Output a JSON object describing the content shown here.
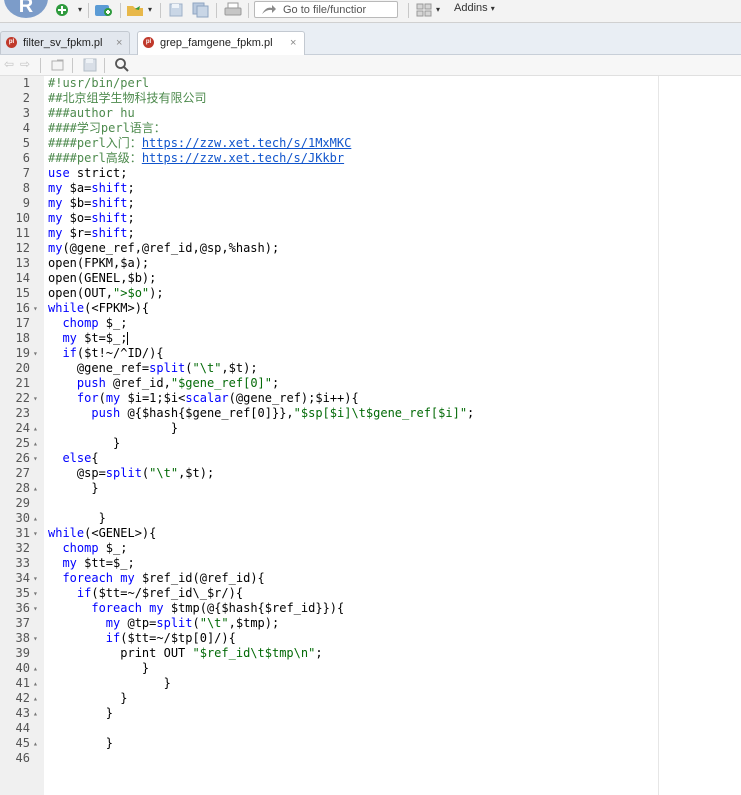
{
  "app": {
    "logo_text": "R",
    "goto_placeholder": "Go to file/functior",
    "addins_label": "Addins"
  },
  "tabs": [
    {
      "label": "filter_sv_fpkm.pl",
      "active": false
    },
    {
      "label": "grep_famgene_fpkm.pl",
      "active": true
    }
  ],
  "colors": {
    "keyword": "#0000ff",
    "comment": "#4d8a4d",
    "string": "#036a07",
    "url": "#1155cc"
  },
  "code_lines": [
    {
      "n": "1",
      "fold": "",
      "html": "<span class='cm'>#!usr/bin/perl</span>"
    },
    {
      "n": "2",
      "fold": "",
      "html": "<span class='cm'>##北京组学生物科技有限公司</span>"
    },
    {
      "n": "3",
      "fold": "",
      "html": "<span class='cm'>###author hu</span>"
    },
    {
      "n": "4",
      "fold": "",
      "html": "<span class='cm'>####学习perl语言：</span>"
    },
    {
      "n": "5",
      "fold": "",
      "html": "<span class='cm'>####perl入门：</span><span class='url'>https://zzw.xet.tech/s/1MxMKC</span>"
    },
    {
      "n": "6",
      "fold": "",
      "html": "<span class='cm'>####perl高级：</span><span class='url'>https://zzw.xet.tech/s/JKkbr</span>"
    },
    {
      "n": "7",
      "fold": "",
      "html": "<span class='kw'>use</span> strict;"
    },
    {
      "n": "8",
      "fold": "",
      "html": "<span class='kw'>my</span> $a=<span class='kw'>shift</span>;"
    },
    {
      "n": "9",
      "fold": "",
      "html": "<span class='kw'>my</span> $b=<span class='kw'>shift</span>;"
    },
    {
      "n": "10",
      "fold": "",
      "html": "<span class='kw'>my</span> $o=<span class='kw'>shift</span>;"
    },
    {
      "n": "11",
      "fold": "",
      "html": "<span class='kw'>my</span> $r=<span class='kw'>shift</span>;"
    },
    {
      "n": "12",
      "fold": "",
      "html": "<span class='kw'>my</span>(@gene_ref,@ref_id,@sp,%hash);"
    },
    {
      "n": "13",
      "fold": "",
      "html": "open(FPKM,$a);"
    },
    {
      "n": "14",
      "fold": "",
      "html": "open(GENEL,$b);"
    },
    {
      "n": "15",
      "fold": "",
      "html": "open(OUT,<span class='st'>\">$o\"</span>);"
    },
    {
      "n": "16",
      "fold": "▾",
      "html": "<span class='kw'>while</span>(&lt;FPKM&gt;){"
    },
    {
      "n": "17",
      "fold": "",
      "html": "  <span class='kw'>chomp</span> $_;"
    },
    {
      "n": "18",
      "fold": "",
      "html": "  <span class='kw'>my</span> $t=$_;<span class='cursor'></span>"
    },
    {
      "n": "19",
      "fold": "▾",
      "html": "  <span class='kw'>if</span>($t!~/^ID/){"
    },
    {
      "n": "20",
      "fold": "",
      "html": "    @gene_ref=<span class='kw'>split</span>(<span class='st'>\"\\t\"</span>,$t);"
    },
    {
      "n": "21",
      "fold": "",
      "html": "    <span class='kw'>push</span> @ref_id,<span class='st'>\"$gene_ref[0]\"</span>;"
    },
    {
      "n": "22",
      "fold": "▾",
      "html": "    <span class='kw'>for</span>(<span class='kw'>my</span> $i=1;$i&lt;<span class='kw'>scalar</span>(@gene_ref);$i++){"
    },
    {
      "n": "23",
      "fold": "",
      "html": "      <span class='kw'>push</span> @{$hash{$gene_ref[0]}},<span class='st'>\"$sp[$i]\\t$gene_ref[$i]\"</span>;"
    },
    {
      "n": "24",
      "fold": "▴",
      "html": "                 }"
    },
    {
      "n": "25",
      "fold": "▴",
      "html": "         }"
    },
    {
      "n": "26",
      "fold": "▾",
      "html": "  <span class='kw'>else</span>{"
    },
    {
      "n": "27",
      "fold": "",
      "html": "    @sp=<span class='kw'>split</span>(<span class='st'>\"\\t\"</span>,$t);"
    },
    {
      "n": "28",
      "fold": "▴",
      "html": "      }"
    },
    {
      "n": "29",
      "fold": "",
      "html": ""
    },
    {
      "n": "30",
      "fold": "▴",
      "html": "       }"
    },
    {
      "n": "31",
      "fold": "▾",
      "html": "<span class='kw'>while</span>(&lt;GENEL&gt;){"
    },
    {
      "n": "32",
      "fold": "",
      "html": "  <span class='kw'>chomp</span> $_;"
    },
    {
      "n": "33",
      "fold": "",
      "html": "  <span class='kw'>my</span> $tt=$_;"
    },
    {
      "n": "34",
      "fold": "▾",
      "html": "  <span class='kw'>foreach</span> <span class='kw'>my</span> $ref_id(@ref_id){"
    },
    {
      "n": "35",
      "fold": "▾",
      "html": "    <span class='kw'>if</span>($tt=~/$ref_id\\_$r/){"
    },
    {
      "n": "36",
      "fold": "▾",
      "html": "      <span class='kw'>foreach</span> <span class='kw'>my</span> $tmp(@{$hash{$ref_id}}){"
    },
    {
      "n": "37",
      "fold": "",
      "html": "        <span class='kw'>my</span> @tp=<span class='kw'>split</span>(<span class='st'>\"\\t\"</span>,$tmp);"
    },
    {
      "n": "38",
      "fold": "▾",
      "html": "        <span class='kw'>if</span>($tt=~/$tp[0]/){"
    },
    {
      "n": "39",
      "fold": "",
      "html": "          print OUT <span class='st'>\"$ref_id\\t$tmp\\n\"</span>;"
    },
    {
      "n": "40",
      "fold": "▴",
      "html": "             }"
    },
    {
      "n": "41",
      "fold": "▴",
      "html": "                }"
    },
    {
      "n": "42",
      "fold": "▴",
      "html": "          }"
    },
    {
      "n": "43",
      "fold": "▴",
      "html": "        }"
    },
    {
      "n": "44",
      "fold": "",
      "html": ""
    },
    {
      "n": "45",
      "fold": "▴",
      "html": "        }"
    },
    {
      "n": "46",
      "fold": "",
      "html": ""
    }
  ]
}
